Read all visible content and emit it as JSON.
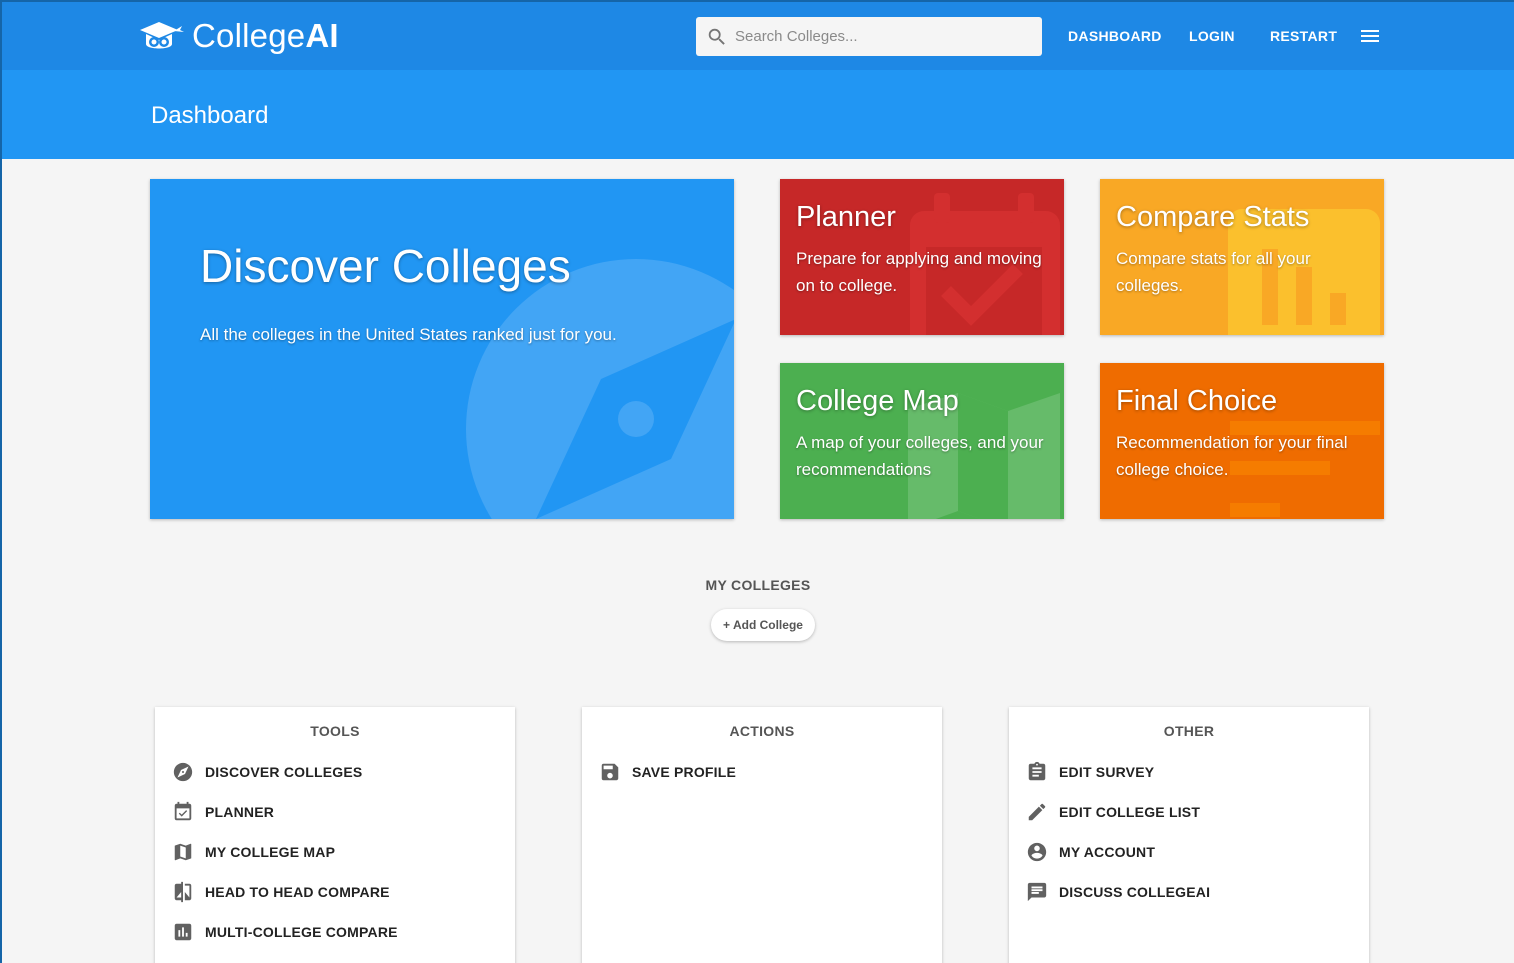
{
  "app": {
    "brand_prefix": "College",
    "brand_suffix": "AI"
  },
  "search": {
    "placeholder": "Search Colleges..."
  },
  "nav": {
    "dashboard": "DASHBOARD",
    "login": "LOGIN",
    "restart": "RESTART"
  },
  "page": {
    "title": "Dashboard"
  },
  "tiles": {
    "discover": {
      "title": "Discover Colleges",
      "desc": "All the colleges in the United States ranked just for you.",
      "color": "#2196f3"
    },
    "planner": {
      "title": "Planner",
      "desc": "Prepare for applying and moving on to college.",
      "color": "#c62828"
    },
    "compare": {
      "title": "Compare Stats",
      "desc": "Compare stats for all your colleges.",
      "color": "#f9a825"
    },
    "map": {
      "title": "College Map",
      "desc": "A map of your colleges, and your recommendations",
      "color": "#4caf50"
    },
    "final": {
      "title": "Final Choice",
      "desc": "Recommendation for your final college choice.",
      "color": "#ef6c00"
    }
  },
  "my_colleges": {
    "heading": "MY COLLEGES",
    "add_label": "+ Add College"
  },
  "panels": {
    "tools": {
      "title": "TOOLS",
      "items": [
        {
          "label": "DISCOVER COLLEGES",
          "icon": "compass-icon"
        },
        {
          "label": "PLANNER",
          "icon": "calendar-check-icon"
        },
        {
          "label": "MY COLLEGE MAP",
          "icon": "map-icon"
        },
        {
          "label": "HEAD TO HEAD COMPARE",
          "icon": "compare-icon"
        },
        {
          "label": "MULTI-COLLEGE COMPARE",
          "icon": "bar-chart-icon"
        }
      ]
    },
    "actions": {
      "title": "ACTIONS",
      "items": [
        {
          "label": "SAVE PROFILE",
          "icon": "save-icon"
        }
      ]
    },
    "other": {
      "title": "OTHER",
      "items": [
        {
          "label": "EDIT SURVEY",
          "icon": "clipboard-icon"
        },
        {
          "label": "EDIT COLLEGE LIST",
          "icon": "pencil-icon"
        },
        {
          "label": "MY ACCOUNT",
          "icon": "account-icon"
        },
        {
          "label": "DISCUSS COLLEGEAI",
          "icon": "chat-icon"
        }
      ]
    }
  }
}
